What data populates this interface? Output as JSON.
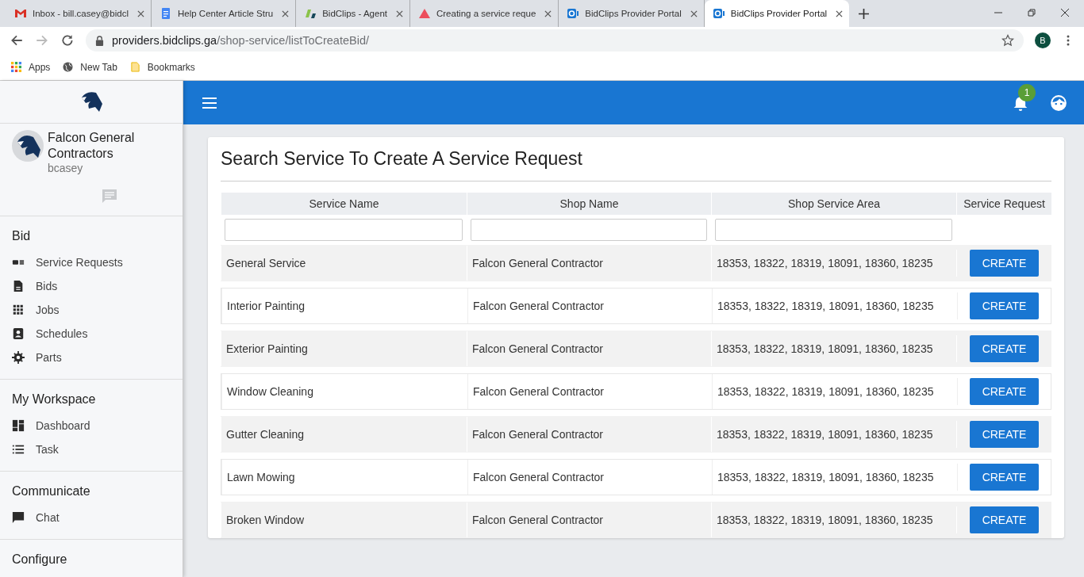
{
  "browser": {
    "tabs": [
      {
        "title": "Inbox - bill.casey@bidcl",
        "selected": false
      },
      {
        "title": "Help Center Article Stru",
        "selected": false
      },
      {
        "title": "BidClips - Agent",
        "selected": false
      },
      {
        "title": "Creating a service reque",
        "selected": false
      },
      {
        "title": "BidClips Provider Portal",
        "selected": false
      },
      {
        "title": "BidClips Provider Portal",
        "selected": true
      }
    ],
    "url_host": "providers.bidclips.ga",
    "url_path": "/shop-service/listToCreateBid/",
    "profile": "B",
    "bookmarks": [
      "Apps",
      "New Tab",
      "Bookmarks"
    ]
  },
  "sidebar": {
    "company": "Falcon General Contractors",
    "username": "bcasey",
    "sections": [
      {
        "title": "Bid",
        "items": [
          "Service Requests",
          "Bids",
          "Jobs",
          "Schedules",
          "Parts"
        ]
      },
      {
        "title": "My Workspace",
        "items": [
          "Dashboard",
          "Task"
        ]
      },
      {
        "title": "Communicate",
        "items": [
          "Chat"
        ]
      },
      {
        "title": "Configure"
      }
    ]
  },
  "topbar": {
    "notification_count": "1"
  },
  "page": {
    "title": "Search Service To Create A Service Request",
    "columns": [
      "Service Name",
      "Shop Name",
      "Shop Service Area",
      "Service Request"
    ],
    "rows": [
      {
        "service": "General Service",
        "shop": "Falcon General Contractor",
        "area": "18353, 18322, 18319, 18091, 18360, 18235",
        "action": "CREATE"
      },
      {
        "service": "Interior Painting",
        "shop": "Falcon General Contractor",
        "area": "18353, 18322, 18319, 18091, 18360, 18235",
        "action": "CREATE"
      },
      {
        "service": "Exterior Painting",
        "shop": "Falcon General Contractor",
        "area": "18353, 18322, 18319, 18091, 18360, 18235",
        "action": "CREATE"
      },
      {
        "service": "Window Cleaning",
        "shop": "Falcon General Contractor",
        "area": "18353, 18322, 18319, 18091, 18360, 18235",
        "action": "CREATE"
      },
      {
        "service": "Gutter Cleaning",
        "shop": "Falcon General Contractor",
        "area": "18353, 18322, 18319, 18091, 18360, 18235",
        "action": "CREATE"
      },
      {
        "service": "Lawn Mowing",
        "shop": "Falcon General Contractor",
        "area": "18353, 18322, 18319, 18091, 18360, 18235",
        "action": "CREATE"
      },
      {
        "service": "Broken Window",
        "shop": "Falcon General Contractor",
        "area": "18353, 18322, 18319, 18091, 18360, 18235",
        "action": "CREATE"
      }
    ]
  }
}
